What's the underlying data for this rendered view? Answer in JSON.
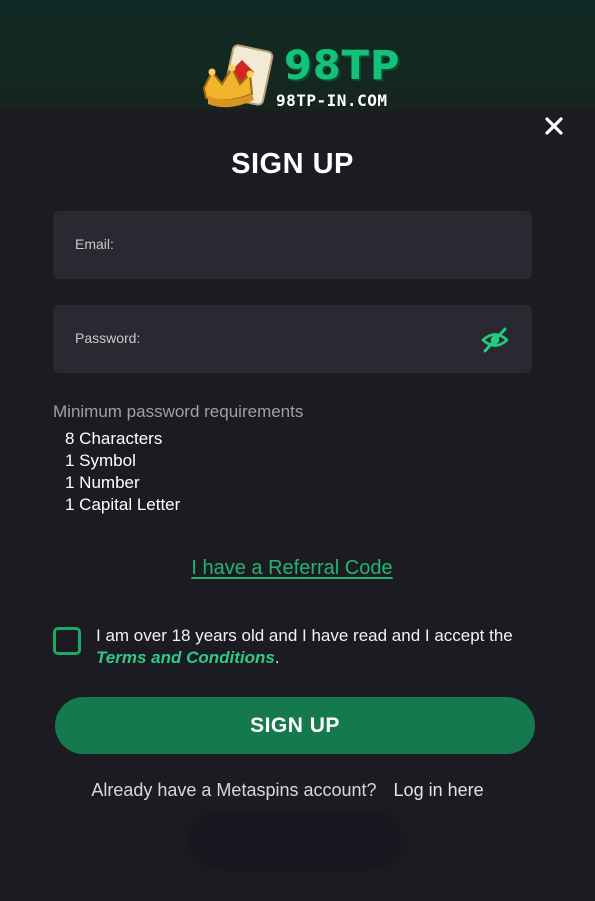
{
  "header": {
    "brand_name": "98TP",
    "brand_domain": "98TP-IN.COM"
  },
  "modal": {
    "title": "SIGN UP",
    "email_label": "Email:",
    "password_label": "Password:",
    "requirements_title": "Minimum password requirements",
    "requirements": [
      "8 Characters",
      "1 Symbol",
      "1 Number",
      "1 Capital Letter"
    ],
    "referral_link": "I have a Referral Code",
    "consent_prefix": "I am over 18 years old and I have read and I accept the",
    "terms_link": "Terms and Conditions",
    "consent_suffix": ".",
    "checkbox_checked": false,
    "signup_button": "SIGN UP",
    "login_prompt": "Already have a Metaspins account?",
    "login_link": "Log in here"
  },
  "icons": {
    "close": "close-icon",
    "eye": "eye-slash-icon",
    "logo": "crown-cards-logo"
  },
  "colors": {
    "accent_green": "#15794e",
    "link_green": "#22b572",
    "background": "#1c1b21",
    "field": "#2a2931"
  }
}
